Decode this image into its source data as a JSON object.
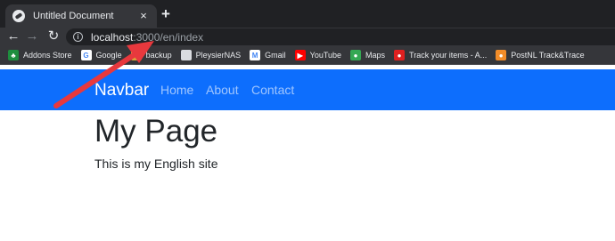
{
  "browser": {
    "tab": {
      "title": "Untitled Document",
      "favicon": "globe-icon",
      "close_glyph": "×"
    },
    "new_tab_glyph": "+",
    "nav": {
      "back_glyph": "←",
      "forward_glyph": "→",
      "reload_glyph": "↻"
    },
    "address": {
      "host": "localhost",
      "rest": ":3000/en/index",
      "info_glyph": "i"
    },
    "bookmarks": [
      {
        "label": "Addons Store",
        "icon": "puzzle-icon",
        "color": "#1e8e3e",
        "glyph": "♣"
      },
      {
        "label": "Google",
        "icon": "google-icon",
        "color": "#ffffff",
        "glyph": "G"
      },
      {
        "label": "backup",
        "icon": "folder-icon",
        "color": "#d9a23a",
        "glyph": ""
      },
      {
        "label": "PleysierNAS",
        "icon": "nas-icon",
        "color": "#dadce0",
        "glyph": ""
      },
      {
        "label": "Gmail",
        "icon": "gmail-icon",
        "color": "#ffffff",
        "glyph": "M"
      },
      {
        "label": "YouTube",
        "icon": "youtube-icon",
        "color": "#ff0000",
        "glyph": "▶"
      },
      {
        "label": "Maps",
        "icon": "maps-icon",
        "color": "#34a853",
        "glyph": "●"
      },
      {
        "label": "Track your items - A...",
        "icon": "track-icon",
        "color": "#e02020",
        "glyph": "●"
      },
      {
        "label": "PostNL Track&Trace",
        "icon": "postnl-icon",
        "color": "#f28c28",
        "glyph": "●"
      }
    ]
  },
  "page": {
    "brand": "Navbar",
    "nav_links": [
      "Home",
      "About",
      "Contact"
    ],
    "title": "My Page",
    "text": "This is my English site"
  },
  "colors": {
    "navbar": "#0d6efd",
    "arrow": "#e8383d"
  }
}
